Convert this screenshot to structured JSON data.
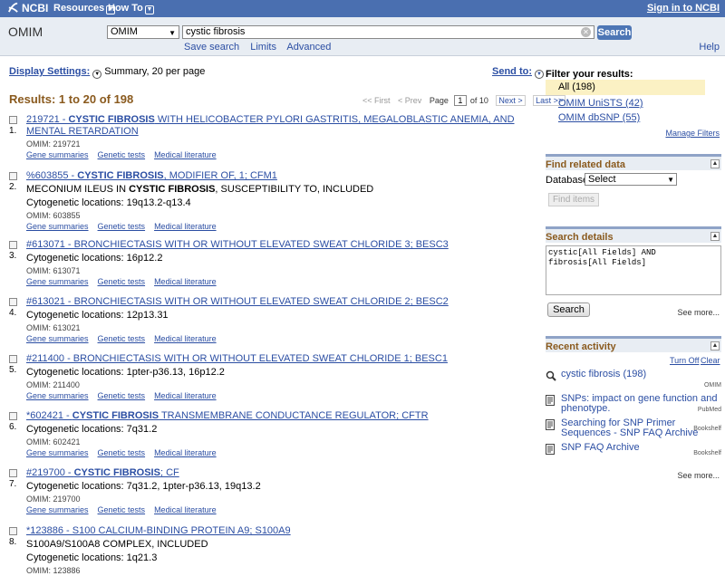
{
  "topbar": {
    "logo": "NCBI",
    "menu_resources": "Resources",
    "menu_howto": "How To",
    "signin": "Sign in to NCBI"
  },
  "search": {
    "db_name": "OMIM",
    "db_select": "OMIM",
    "term": "cystic fibrosis",
    "search_btn": "Search",
    "save_search": "Save search",
    "limits": "Limits",
    "advanced": "Advanced",
    "help": "Help"
  },
  "display": {
    "settings_label": "Display Settings:",
    "settings_value": "Summary, 20 per page",
    "send_to": "Send to:"
  },
  "results_title": "Results: 1 to 20 of 198",
  "pager": {
    "first": "<< First",
    "prev": "< Prev",
    "page_label": "Page",
    "page": "1",
    "of": "of 10",
    "next": "Next >",
    "last": "Last >>"
  },
  "link_labels": {
    "gene": "Gene summaries",
    "tests": "Genetic tests",
    "lit": "Medical literature"
  },
  "results": [
    {
      "num": "1.",
      "t1": "219721 - ",
      "t2": "CYSTIC FIBROSIS",
      "t3": " WITH HELICOBACTER PYLORI GASTRITIS, MEGALOBLASTIC ANEMIA, AND MENTAL RETARDATION",
      "lines": [],
      "omim": "OMIM: 219721"
    },
    {
      "num": "2.",
      "t1": "%603855 - ",
      "t2": "CYSTIC FIBROSIS",
      "t3": ", MODIFIER OF, 1; CFM1",
      "lines": [
        {
          "a": "MECONIUM ILEUS IN ",
          "b": "CYSTIC FIBROSIS",
          "c": ", SUSCEPTIBILITY TO, INCLUDED"
        },
        {
          "a": "Cytogenetic locations: 19q13.2-q13.4",
          "b": "",
          "c": ""
        }
      ],
      "omim": "OMIM: 603855"
    },
    {
      "num": "3.",
      "t1": "#613071 - BRONCHIECTASIS WITH OR WITHOUT ELEVATED SWEAT CHLORIDE 3; BESC3",
      "t2": "",
      "t3": "",
      "lines": [
        {
          "a": "Cytogenetic locations: 16p12.2",
          "b": "",
          "c": ""
        }
      ],
      "omim": "OMIM: 613071"
    },
    {
      "num": "4.",
      "t1": "#613021 - BRONCHIECTASIS WITH OR WITHOUT ELEVATED SWEAT CHLORIDE 2; BESC2",
      "t2": "",
      "t3": "",
      "lines": [
        {
          "a": "Cytogenetic locations: 12p13.31",
          "b": "",
          "c": ""
        }
      ],
      "omim": "OMIM: 613021"
    },
    {
      "num": "5.",
      "t1": "#211400 - BRONCHIECTASIS WITH OR WITHOUT ELEVATED SWEAT CHLORIDE 1; BESC1",
      "t2": "",
      "t3": "",
      "lines": [
        {
          "a": "Cytogenetic locations: 1pter-p36.13, 16p12.2",
          "b": "",
          "c": ""
        }
      ],
      "omim": "OMIM: 211400"
    },
    {
      "num": "6.",
      "t1": "*602421 - ",
      "t2": "CYSTIC FIBROSIS",
      "t3": " TRANSMEMBRANE CONDUCTANCE REGULATOR; CFTR",
      "lines": [
        {
          "a": "Cytogenetic locations: 7q31.2",
          "b": "",
          "c": ""
        }
      ],
      "omim": "OMIM: 602421"
    },
    {
      "num": "7.",
      "t1": "#219700 - ",
      "t2": "CYSTIC FIBROSIS",
      "t3": "; CF",
      "lines": [
        {
          "a": "Cytogenetic locations: 7q31.2, 1pter-p36.13, 19q13.2",
          "b": "",
          "c": ""
        }
      ],
      "omim": "OMIM: 219700"
    },
    {
      "num": "8.",
      "t1": "*123886 - S100 CALCIUM-BINDING PROTEIN A9; S100A9",
      "t2": "",
      "t3": "",
      "lines": [
        {
          "a": "S100A9/S100A8 COMPLEX, INCLUDED",
          "b": "",
          "c": ""
        },
        {
          "a": "Cytogenetic locations: 1q21.3",
          "b": "",
          "c": ""
        }
      ],
      "omim": "OMIM: 123886"
    }
  ],
  "sidebar": {
    "filter_header": "Filter your results:",
    "filter_all": "All (198)",
    "filter_unists": "OMIM UniSTS (42)",
    "filter_dbsnp": "OMIM dbSNP (55)",
    "manage": "Manage Filters",
    "related_header": "Find related data",
    "db_label": "Database:",
    "db_select": "Select",
    "find_items": "Find items",
    "details_header": "Search details",
    "details_text": "cystic[All Fields] AND fibrosis[All Fields]",
    "search_btn": "Search",
    "see_more": "See more...",
    "recent_header": "Recent activity",
    "turn_off": "Turn Off",
    "clear": "Clear",
    "recent": [
      {
        "text": "cystic fibrosis (198)",
        "src": "OMIM",
        "icon": "search-icon"
      },
      {
        "text": "SNPs: impact on gene function and phenotype.",
        "src": "PubMed",
        "icon": "document-icon"
      },
      {
        "text": "Searching for SNP Primer Sequences - SNP FAQ Archive",
        "src": "Bookshelf",
        "icon": "document-icon"
      },
      {
        "text": "SNP FAQ Archive",
        "src": "Bookshelf",
        "icon": "document-icon"
      }
    ],
    "see_more2": "See more..."
  }
}
